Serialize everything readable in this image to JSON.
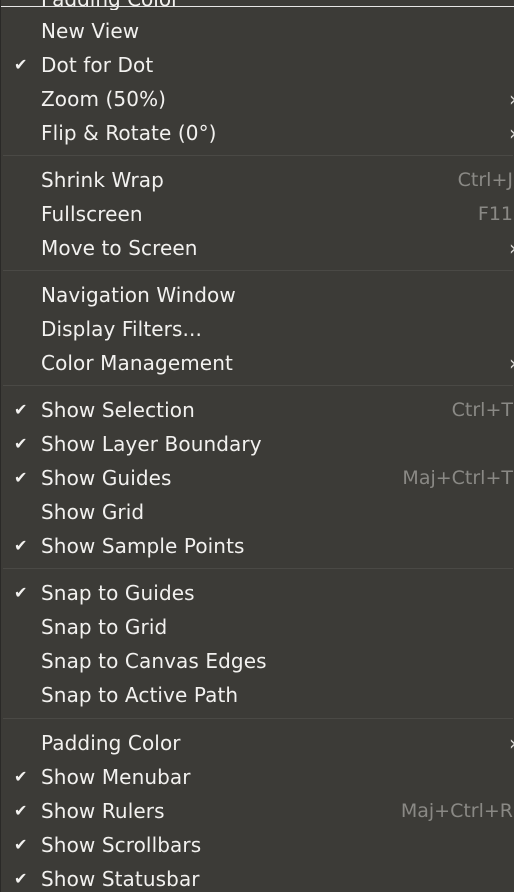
{
  "menu": {
    "top_partial_label": "Padding Color",
    "items": [
      {
        "label": "New View",
        "checked": false,
        "accel": "",
        "submenu": false
      },
      {
        "label": "Dot for Dot",
        "checked": true,
        "accel": "",
        "submenu": false
      },
      {
        "label": "Zoom (50%)",
        "checked": false,
        "accel": "",
        "submenu": true
      },
      {
        "label": "Flip & Rotate (0°)",
        "checked": false,
        "accel": "",
        "submenu": true
      },
      {
        "label": "Shrink Wrap",
        "checked": false,
        "accel": "Ctrl+J",
        "submenu": false
      },
      {
        "label": "Fullscreen",
        "checked": false,
        "accel": "F11",
        "submenu": false
      },
      {
        "label": "Move to Screen",
        "checked": false,
        "accel": "",
        "submenu": true
      },
      {
        "label": "Navigation Window",
        "checked": false,
        "accel": "",
        "submenu": false
      },
      {
        "label": "Display Filters...",
        "checked": false,
        "accel": "",
        "submenu": false
      },
      {
        "label": "Color Management",
        "checked": false,
        "accel": "",
        "submenu": true
      },
      {
        "label": "Show Selection",
        "checked": true,
        "accel": "Ctrl+T",
        "submenu": false
      },
      {
        "label": "Show Layer Boundary",
        "checked": true,
        "accel": "",
        "submenu": false
      },
      {
        "label": "Show Guides",
        "checked": true,
        "accel": "Maj+Ctrl+T",
        "submenu": false
      },
      {
        "label": "Show Grid",
        "checked": false,
        "accel": "",
        "submenu": false
      },
      {
        "label": "Show Sample Points",
        "checked": true,
        "accel": "",
        "submenu": false
      },
      {
        "label": "Snap to Guides",
        "checked": true,
        "accel": "",
        "submenu": false
      },
      {
        "label": "Snap to Grid",
        "checked": false,
        "accel": "",
        "submenu": false
      },
      {
        "label": "Snap to Canvas Edges",
        "checked": false,
        "accel": "",
        "submenu": false
      },
      {
        "label": "Snap to Active Path",
        "checked": false,
        "accel": "",
        "submenu": false
      },
      {
        "label": "Padding Color",
        "checked": false,
        "accel": "",
        "submenu": true
      },
      {
        "label": "Show Menubar",
        "checked": true,
        "accel": "",
        "submenu": false
      },
      {
        "label": "Show Rulers",
        "checked": true,
        "accel": "Maj+Ctrl+R",
        "submenu": false
      },
      {
        "label": "Show Scrollbars",
        "checked": true,
        "accel": "",
        "submenu": false
      },
      {
        "label": "Show Statusbar",
        "checked": true,
        "accel": "",
        "submenu": false
      }
    ],
    "check_glyph": "✔",
    "submenu_glyph": "›"
  },
  "colors": {
    "background": "#3c3b37",
    "text": "#f2f1ef",
    "accelerator": "#8a8985",
    "separator": "#4a4945"
  }
}
